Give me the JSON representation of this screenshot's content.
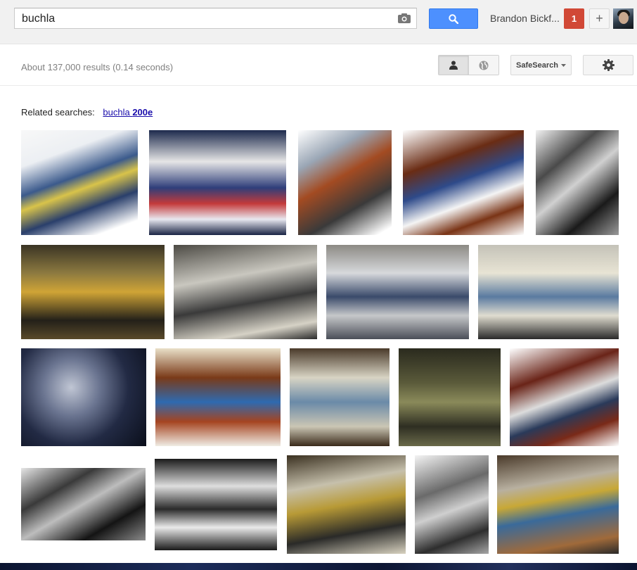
{
  "search": {
    "query": "buchla"
  },
  "header": {
    "user_name": "Brandon Bickf...",
    "notification_count": "1",
    "share_symbol": "+"
  },
  "results_stats": "About 137,000 results (0.14 seconds)",
  "toolbar": {
    "safesearch_label": "SafeSearch"
  },
  "related": {
    "label": "Related searches:",
    "link_plain": "buchla ",
    "link_bold": "200e"
  },
  "colors": {
    "search_button": "#4d90fe",
    "notification": "#d14836",
    "link": "#1a0dab"
  },
  "thumbnails": [
    {
      "bg": "linear-gradient(160deg,#f8f8f8 0%,#eceff3 25%,#3b5a8c 45%,#d8c34a 55%,#2a3f6b 70%,#ffffff 90%)"
    },
    {
      "bg": "linear-gradient(180deg,#1d2a4d 0%,#e6e6e6 30%,#2f3e7a 55%,#c43a3a 70%,#e8e8f0 85%,#1a2444 100%)"
    },
    {
      "bg": "linear-gradient(150deg,#ffffff 0%,#9aa6b5 25%,#a34b22 45%,#3a3a3a 70%,#ffffff 95%)"
    },
    {
      "bg": "linear-gradient(160deg,#ffffff 0%,#6a2c14 30%,#2e4a8a 48%,#f4f4f4 65%,#7a3416 80%,#ffffff 100%)"
    },
    {
      "bg": "linear-gradient(140deg,#f2f2f2 0%,#4a4a4a 30%,#d0d0d0 50%,#1a1a1a 75%,#9a9a9a 100%)"
    },
    {
      "bg": "linear-gradient(180deg,#3a3424 0%,#8d7a40 30%,#d0a436 50%,#232019 80%,#5a4a2a 100%)"
    },
    {
      "bg": "linear-gradient(170deg,#4c4a44 0%,#c9c7bf 35%,#3a3a3a 60%,#d6d2c6 85%,#2a2a2a 100%)"
    },
    {
      "bg": "linear-gradient(180deg,#8c8a84 0%,#d7d9dc 30%,#3a4a6a 55%,#c6c8ca 75%,#4a4e58 100%)"
    },
    {
      "bg": "linear-gradient(180deg,#c4c2b8 0%,#e8e4d4 30%,#5a7aa0 55%,#e0ddd0 75%,#2a2a2a 100%)"
    },
    {
      "bg": "radial-gradient(circle at 40% 40%,#c0c6d4 0%,#6a7490 30%,#222a44 60%,#0a0e1a 100%)"
    },
    {
      "bg": "linear-gradient(180deg,#e9e0c8 0%,#7a3a18 30%,#2e6ab0 55%,#a54420 75%,#f0ece4 100%)"
    },
    {
      "bg": "linear-gradient(180deg,#4a3a2a 0%,#d8d4c4 30%,#6a8aa8 55%,#cbc6b4 80%,#3a2a1a 100%)"
    },
    {
      "bg": "linear-gradient(180deg,#2a2a1e 0%,#5a5a3a 35%,#8a8a5a 55%,#2e2e22 80%,#6a6a4a 100%)"
    },
    {
      "bg": "linear-gradient(160deg,#ffffff 0%,#6a2418 30%,#dcdcdc 50%,#2a3a5a 65%,#7a2a18 80%,#ffffff 100%)"
    },
    {
      "bg": "linear-gradient(150deg,#e6e6e6 0%,#3a3a3a 30%,#bdbdbd 50%,#141414 75%,#8a8a8a 100%)"
    },
    {
      "bg": "linear-gradient(180deg,#1a1a1a 0%,#dedede 30%,#2a2a2a 55%,#eaeaea 75%,#1a1a1a 100%)"
    },
    {
      "bg": "linear-gradient(170deg,#3a3020 0%,#c6c0ac 30%,#b89a36 50%,#2a2a28 75%,#d8d2c0 100%)"
    },
    {
      "bg": "linear-gradient(160deg,#f4f4f4 0%,#6a6a6a 35%,#cfcfcf 55%,#2e2e2e 80%,#a6a6a6 100%)"
    },
    {
      "bg": "linear-gradient(170deg,#4a3a2a 0%,#b8b0a0 30%,#c8a836 45%,#3a6a9a 60%,#a06a3a 85%,#2a2a2a 100%)"
    }
  ]
}
